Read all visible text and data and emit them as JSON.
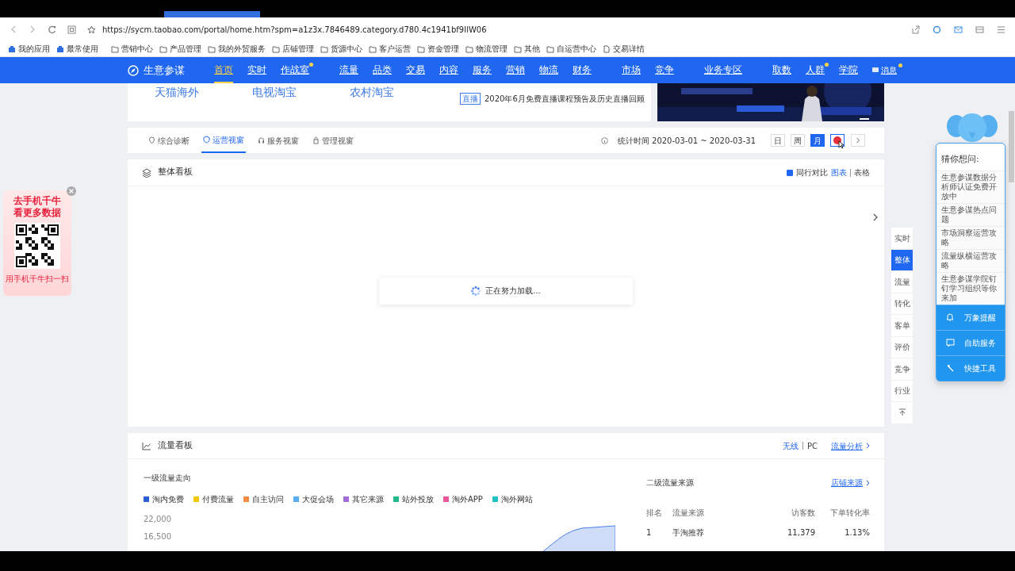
{
  "browser": {
    "url": "https://sycm.taobao.com/portal/home.htm?spm=a1z3x.7846489.category.d780.4c1941bf9IlW06",
    "bookmarks": [
      {
        "label": "我的应用",
        "kind": "app"
      },
      {
        "label": "最常使用",
        "kind": "app"
      },
      {
        "label": "营销中心",
        "kind": "folder"
      },
      {
        "label": "产品管理",
        "kind": "folder"
      },
      {
        "label": "我的外贸服务",
        "kind": "folder"
      },
      {
        "label": "店铺管理",
        "kind": "folder"
      },
      {
        "label": "货源中心",
        "kind": "folder"
      },
      {
        "label": "客户运营",
        "kind": "folder"
      },
      {
        "label": "资金管理",
        "kind": "folder"
      },
      {
        "label": "物流管理",
        "kind": "folder"
      },
      {
        "label": "其他",
        "kind": "folder"
      },
      {
        "label": "自运营中心",
        "kind": "folder"
      },
      {
        "label": "交易详情",
        "kind": "page"
      }
    ]
  },
  "nav": {
    "brand": "生意参谋",
    "groups": [
      [
        {
          "label": "首页",
          "selected": true,
          "dot": false
        },
        {
          "label": "实时",
          "selected": false,
          "dot": false
        },
        {
          "label": "作战室",
          "selected": false,
          "dot": true
        }
      ],
      [
        {
          "label": "流量",
          "selected": false,
          "dot": false
        },
        {
          "label": "品类",
          "selected": false,
          "dot": false
        },
        {
          "label": "交易",
          "selected": false,
          "dot": false
        },
        {
          "label": "内容",
          "selected": false,
          "dot": false
        },
        {
          "label": "服务",
          "selected": false,
          "dot": false
        },
        {
          "label": "营销",
          "selected": false,
          "dot": false
        },
        {
          "label": "物流",
          "selected": false,
          "dot": false
        },
        {
          "label": "财务",
          "selected": false,
          "dot": false
        }
      ],
      [
        {
          "label": "市场",
          "selected": false,
          "dot": false
        },
        {
          "label": "竞争",
          "selected": false,
          "dot": false
        }
      ],
      [
        {
          "label": "业务专区",
          "selected": false,
          "dot": false
        }
      ],
      [
        {
          "label": "取数",
          "selected": false,
          "dot": false
        },
        {
          "label": "人群",
          "selected": false,
          "dot": true
        },
        {
          "label": "学院",
          "selected": false,
          "dot": false
        }
      ]
    ],
    "messages": {
      "label": "消息",
      "dot": true
    }
  },
  "banner": {
    "channels": [
      "天猫海外",
      "电视淘宝",
      "农村淘宝"
    ],
    "notice": {
      "tag": "直播",
      "text": "2020年6月免费直播课程预告及历史直播回顾"
    },
    "image": {
      "kind": "picture"
    }
  },
  "view_tabs": {
    "tabs": [
      {
        "label": "综合诊断",
        "selected": false
      },
      {
        "label": "运营视窗",
        "selected": true
      },
      {
        "label": "服务视窗",
        "selected": false
      },
      {
        "label": "管理视窗",
        "selected": false
      }
    ],
    "period": "统计时间 2020-03-01 ~ 2020-03-31",
    "ranges": [
      {
        "label": "日",
        "selected": false
      },
      {
        "label": "周",
        "selected": false
      },
      {
        "label": "月",
        "selected": true
      },
      {
        "selected": false,
        "clicked": true
      }
    ]
  },
  "overview": {
    "title": "整体看板",
    "compare": {
      "label": "同行对比",
      "checked": true
    },
    "views": [
      {
        "label": "图表",
        "selected": true
      },
      {
        "label": "表格",
        "selected": false
      }
    ],
    "loading": "正在努力加载..."
  },
  "traffic": {
    "title": "流量看板",
    "devices": [
      {
        "label": "无线",
        "selected": true
      },
      {
        "label": "PC",
        "selected": false
      }
    ],
    "link": "流量分析",
    "trend": {
      "title": "一级流量走向",
      "legend": [
        {
          "label": "淘内免费",
          "color": "#2d5fd6"
        },
        {
          "label": "付费流量",
          "color": "#f2c811"
        },
        {
          "label": "自主访问",
          "color": "#f58b45"
        },
        {
          "label": "大促会场",
          "color": "#59aef2"
        },
        {
          "label": "其它来源",
          "color": "#a46ddb"
        },
        {
          "label": "站外投放",
          "color": "#22b88c"
        },
        {
          "label": "淘外APP",
          "color": "#e9579b"
        },
        {
          "label": "淘外网站",
          "color": "#1fc3c3"
        }
      ],
      "y_labels": [
        "22,000",
        "16,500"
      ]
    },
    "sources": {
      "title": "二级流量来源",
      "link": "店铺来源",
      "columns": [
        "排名",
        "流量来源",
        "访客数",
        "下单转化率"
      ],
      "rows": [
        [
          "1",
          "手淘推荐",
          "11,379",
          "1.13%"
        ]
      ]
    }
  },
  "side_nav": [
    {
      "label": "实时",
      "selected": false
    },
    {
      "label": "整体",
      "selected": true
    },
    {
      "label": "流量",
      "selected": false
    },
    {
      "label": "转化",
      "selected": false
    },
    {
      "label": "客单",
      "selected": false
    },
    {
      "label": "评价",
      "selected": false
    },
    {
      "label": "竞争",
      "selected": false
    },
    {
      "label": "行业",
      "selected": false
    }
  ],
  "helper": {
    "title": "猜你想问:",
    "questions": [
      "生意参谋数据分析师认证免费开放中",
      "生意参谋热点问题",
      "市场洞察运营攻略",
      "流量纵横运营攻略",
      "生意参谋学院钉钉学习组织等你来加"
    ],
    "actions": [
      {
        "label": "万象提醒"
      },
      {
        "label": "自助服务"
      },
      {
        "label": "快捷工具"
      }
    ]
  },
  "qr_ad": {
    "headline": [
      "去手机千牛",
      "看更多数据"
    ],
    "caption": "用手机千牛扫一扫"
  }
}
